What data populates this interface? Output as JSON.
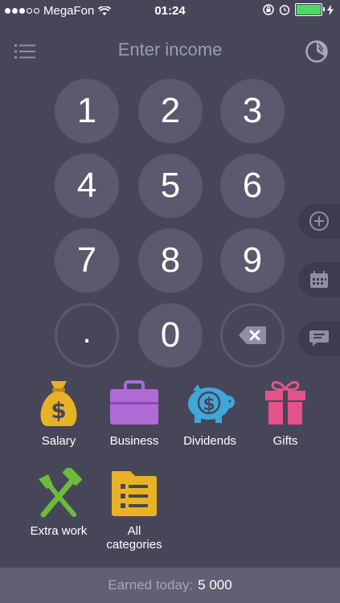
{
  "status_bar": {
    "carrier": "MegaFon",
    "time": "01:24",
    "signal_dots_filled": 3,
    "signal_dots_total": 5,
    "battery_level": 1.0
  },
  "header": {
    "title": "Enter income"
  },
  "keypad": {
    "keys": [
      "1",
      "2",
      "3",
      "4",
      "5",
      "6",
      "7",
      "8",
      "9",
      ".",
      "0"
    ]
  },
  "categories": [
    {
      "label": "Salary"
    },
    {
      "label": "Business"
    },
    {
      "label": "Dividends"
    },
    {
      "label": "Gifts"
    },
    {
      "label": "Extra work"
    },
    {
      "label_line1": "All",
      "label_line2": "categories"
    }
  ],
  "footer": {
    "label": "Earned today:",
    "value": "5 000"
  },
  "colors": {
    "background": "#474659",
    "key": "#5a596e",
    "footer": "#605f73",
    "accent_green": "#4cd964"
  }
}
